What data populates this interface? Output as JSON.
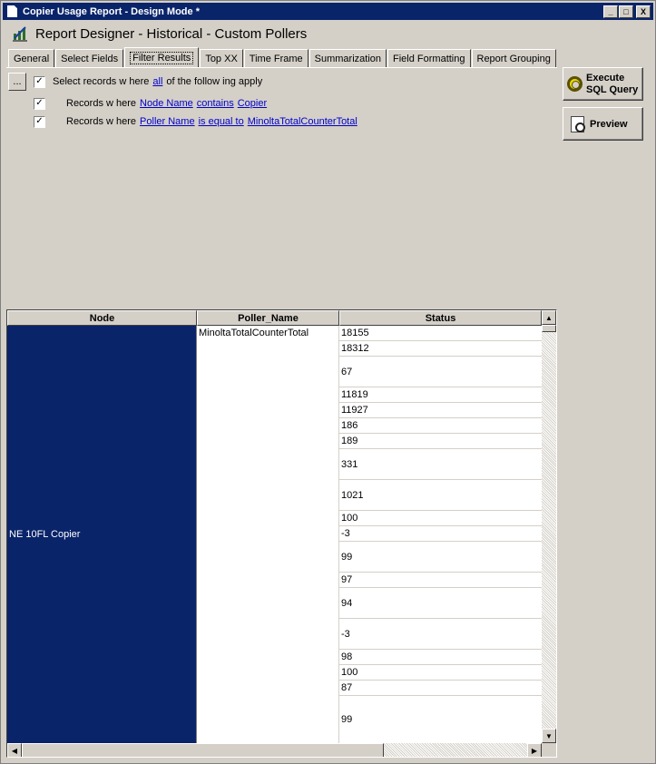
{
  "window": {
    "title": "Copier Usage Report - Design Mode *",
    "controls": {
      "minimize": "_",
      "maximize": "□",
      "close": "X"
    }
  },
  "header": {
    "title": "Report Designer - Historical - Custom Pollers",
    "icon": "report-designer-icon"
  },
  "tabs": [
    {
      "label": "General"
    },
    {
      "label": "Select Fields"
    },
    {
      "label": "Filter Results",
      "active": true
    },
    {
      "label": "Top XX"
    },
    {
      "label": "Time Frame"
    },
    {
      "label": "Summarization"
    },
    {
      "label": "Field Formatting"
    },
    {
      "label": "Report Grouping"
    }
  ],
  "filter": {
    "more_button": "...",
    "root": {
      "checked": true,
      "prefix": "Select records w here",
      "link": "all",
      "suffix": "of the follow ing apply"
    },
    "conditions": [
      {
        "checked": true,
        "prefix": "Records w here",
        "field": "Node Name",
        "operator": "contains",
        "value": "Copier"
      },
      {
        "checked": true,
        "prefix": "Records w here",
        "field": "Poller Name",
        "operator": "is equal to",
        "value": "MinoltaTotalCounterTotal"
      }
    ]
  },
  "buttons": {
    "execute_line1": "Execute",
    "execute_line2": "SQL Query",
    "preview": "Preview"
  },
  "grid": {
    "columns": [
      "Node",
      "Poller_Name",
      "Status"
    ],
    "node": "NE 10FL Copier",
    "poller_name": "MinoltaTotalCounterTotal",
    "status": [
      "18155",
      "18312",
      "67",
      "11819",
      "11927",
      "186",
      "189",
      "331",
      "1021",
      "100",
      "-3",
      "99",
      "97",
      "94",
      "-3",
      "98",
      "100",
      "87",
      "99"
    ]
  },
  "colors": {
    "titlebar": "#0a246a",
    "selection": "#0a246a",
    "link": "#0000cc",
    "face": "#d4d0c8"
  }
}
